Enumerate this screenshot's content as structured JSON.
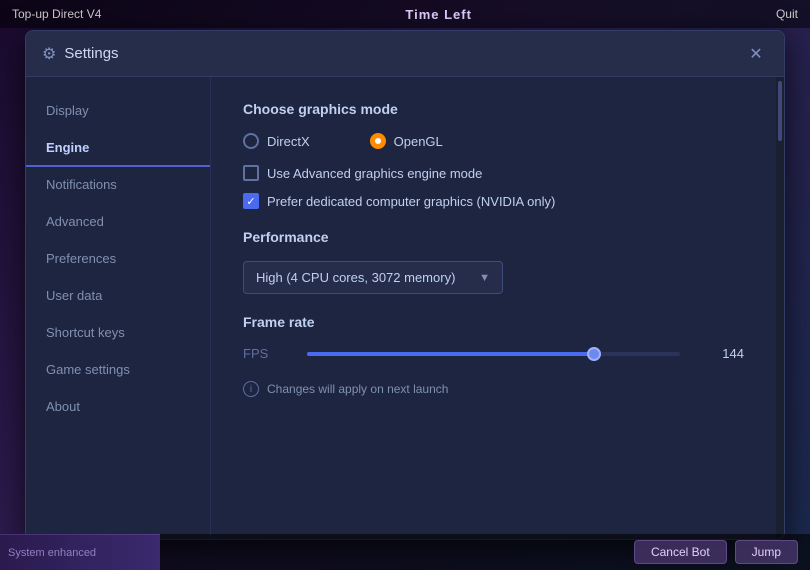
{
  "topbar": {
    "left": "Top-up  Direct V4",
    "center": "Time Left",
    "right": "Quit"
  },
  "bottombar": {
    "left_label": "System enhanced",
    "cancel_label": "Cancel Bot",
    "jump_label": "Jump"
  },
  "modal": {
    "title": "Settings",
    "close_label": "✕"
  },
  "sidebar": {
    "items": [
      {
        "id": "display",
        "label": "Display"
      },
      {
        "id": "engine",
        "label": "Engine",
        "active": true
      },
      {
        "id": "notifications",
        "label": "Notifications"
      },
      {
        "id": "advanced",
        "label": "Advanced"
      },
      {
        "id": "preferences",
        "label": "Preferences"
      },
      {
        "id": "user-data",
        "label": "User data"
      },
      {
        "id": "shortcut-keys",
        "label": "Shortcut keys"
      },
      {
        "id": "game-settings",
        "label": "Game settings"
      },
      {
        "id": "about",
        "label": "About"
      }
    ]
  },
  "content": {
    "graphics_title": "Choose graphics mode",
    "directx_label": "DirectX",
    "opengl_label": "OpenGL",
    "advanced_graphics_label": "Use Advanced graphics engine mode",
    "dedicated_graphics_label": "Prefer dedicated computer graphics (NVIDIA only)",
    "performance_title": "Performance",
    "performance_dropdown": "High (4 CPU cores, 3072 memory)",
    "framerate_title": "Frame rate",
    "fps_label": "FPS",
    "fps_value": "144",
    "slider_percent": 77,
    "note": "Changes will apply on next launch"
  }
}
